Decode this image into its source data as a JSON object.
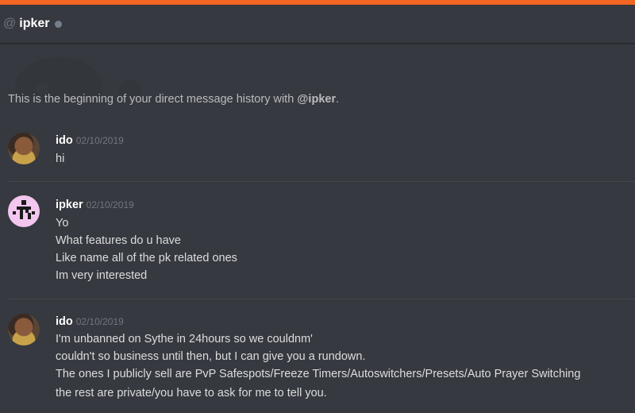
{
  "header": {
    "at_symbol": "@",
    "username": "ipker",
    "status_color": "#747f8d",
    "accent_color": "#f26522"
  },
  "intro": {
    "prefix": "This is the beginning of your direct message history with ",
    "mention": "@ipker",
    "suffix": "."
  },
  "messages": [
    {
      "author": "ido",
      "timestamp": "02/10/2019",
      "avatar": "ido-avatar",
      "lines": [
        "hi"
      ]
    },
    {
      "author": "ipker",
      "timestamp": "02/10/2019",
      "avatar": "ipker-avatar",
      "lines": [
        "Yo",
        "What features do u have",
        "Like name all of the pk related ones",
        "Im very interested"
      ]
    },
    {
      "author": "ido",
      "timestamp": "02/10/2019",
      "avatar": "ido-avatar",
      "lines": [
        "I'm unbanned on Sythe in 24hours so we couldnm'",
        "couldn't so business until then, but I can give you a rundown.",
        "The ones I publicly sell are PvP Safespots/Freeze Timers/Autoswitchers/Presets/Auto Prayer Switching",
        "the rest are private/you have to ask for me to tell you."
      ]
    }
  ]
}
